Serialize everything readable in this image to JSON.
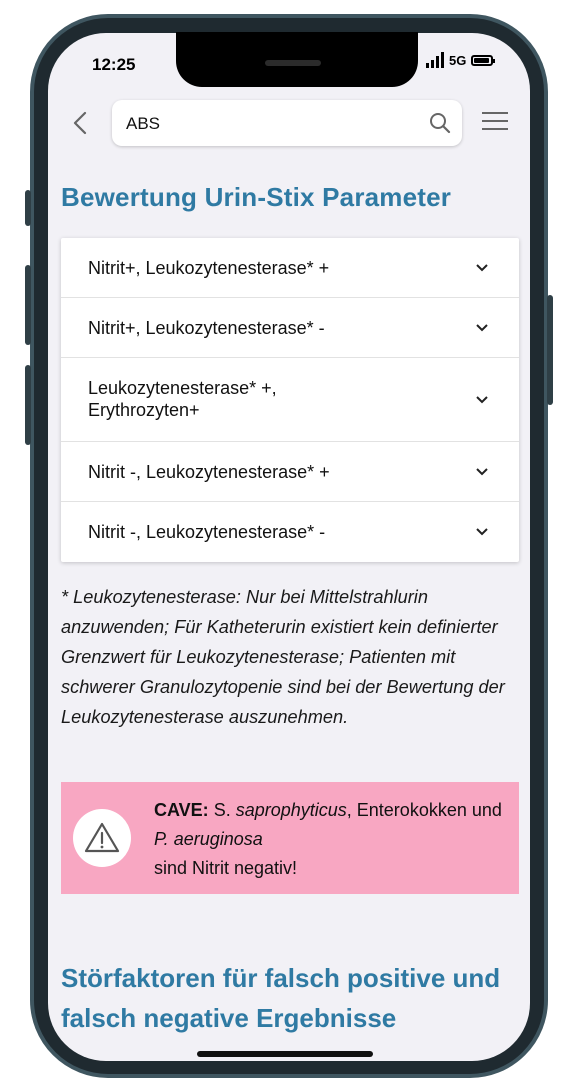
{
  "status_bar": {
    "time": "12:25",
    "network": "5G"
  },
  "header": {
    "search_value": "ABS"
  },
  "section1": {
    "title": "Bewertung Urin-Stix Parameter",
    "items": [
      {
        "label": "Nitrit+, Leukozytenesterase* +"
      },
      {
        "label": "Nitrit+, Leukozytenesterase* -"
      },
      {
        "label": "Leukozytenesterase* +, Erythrozyten+"
      },
      {
        "label": "Nitrit -, Leukozytenesterase* +"
      },
      {
        "label": "Nitrit -, Leukozytenesterase* -"
      }
    ],
    "footnote": "* Leukozytenesterase: Nur bei Mittelstrahlurin anzuwenden; Für Katheterurin existiert kein definierter Grenzwert für Leukozytenesterase; Patienten mit schwerer Granulozytopenie sind bei der Bewertung der Leukozytenesterase auszunehmen."
  },
  "cave": {
    "prefix": "CAVE:",
    "part1": "S.",
    "organism1": "saprophyticus",
    "part2": ", Enterokokken und",
    "organism2_genus": "P.",
    "organism2": "aeruginosa",
    "part3": "sind Nitrit negativ!",
    "background_color": "#f8a7c2",
    "icon": "warning-triangle-icon"
  },
  "section2": {
    "title": "Störfaktoren für falsch positive und falsch negative Ergebnisse"
  },
  "colors": {
    "heading": "#2f7aa3",
    "screen_background": "#f2f1f6"
  }
}
